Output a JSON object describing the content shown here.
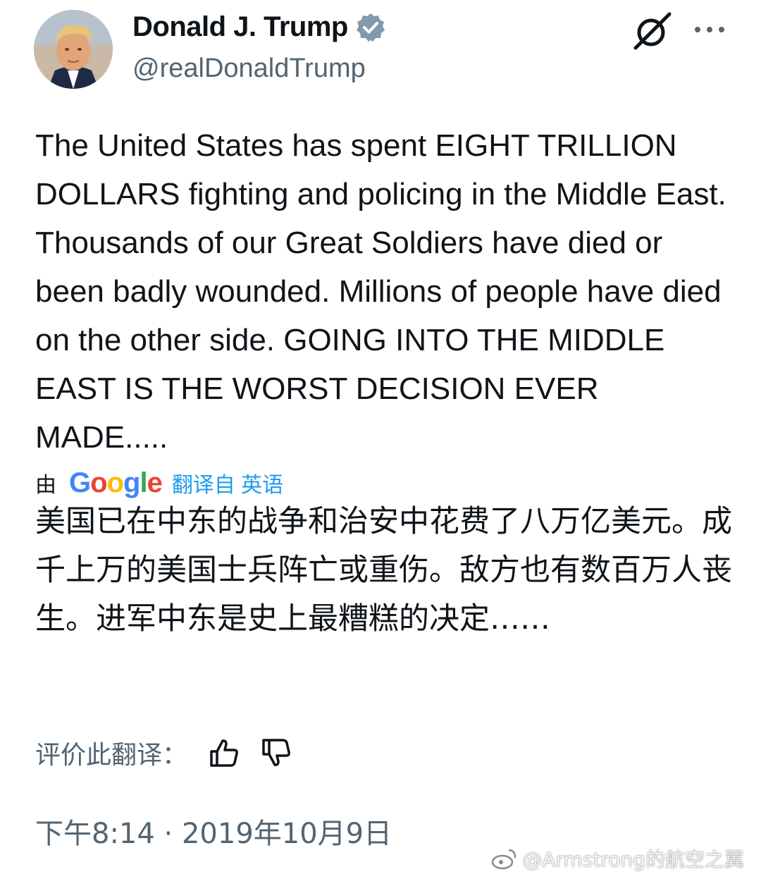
{
  "author": {
    "display_name": "Donald J. Trump",
    "handle": "@realDonaldTrump",
    "verified": true
  },
  "icons": [
    "grok-icon",
    "more-options-icon",
    "verified-badge-icon",
    "thumbs-up-icon",
    "thumbs-down-icon",
    "weibo-icon"
  ],
  "tweet": {
    "text": "The United States has spent EIGHT TRILLION DOLLARS fighting and policing in the Middle East. Thousands of our Great Soldiers have died or been badly wounded. Millions of people have died on the other side. GOING INTO THE MIDDLE EAST IS THE WORST DECISION EVER MADE....."
  },
  "translation": {
    "by_label": "由",
    "provider": "Google",
    "from_label": "翻译自 英语",
    "text": "美国已在中东的战争和治安中花费了八万亿美元。成千上万的美国士兵阵亡或重伤。敌方也有数百万人丧生。进军中东是史上最糟糕的决定……",
    "rate_label": "评价此翻译："
  },
  "timestamp": "下午8:14 · 2019年10月9日",
  "watermark": "@Armstrong的航空之翼",
  "colors": {
    "text": "#0f1419",
    "secondary": "#536471",
    "link": "#1d9bf0",
    "verified": "#829aab",
    "google_blue": "#4285F4",
    "google_red": "#EA4335",
    "google_yellow": "#FBBC05",
    "google_green": "#34A853"
  }
}
